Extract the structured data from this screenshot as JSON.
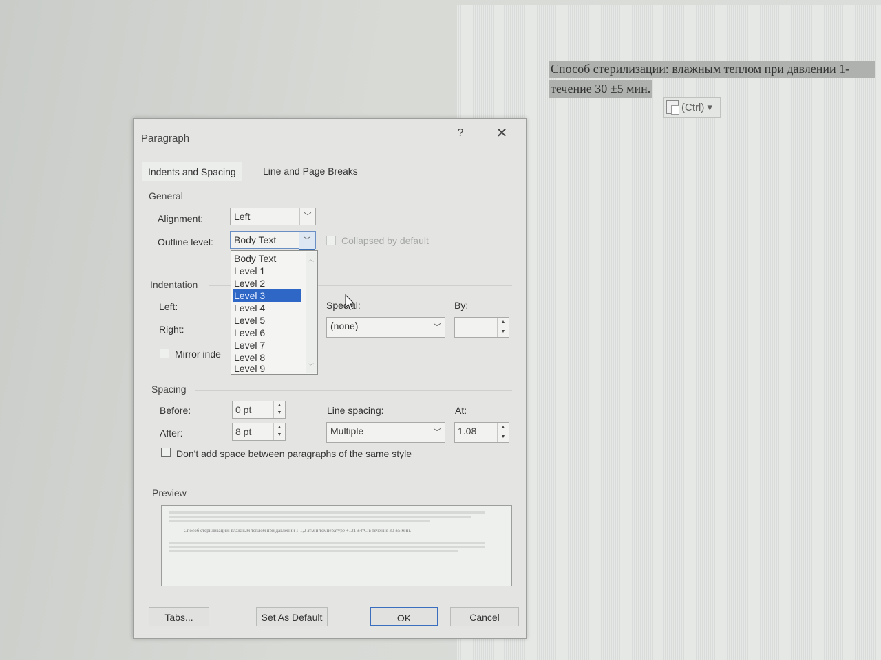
{
  "document": {
    "line1": "Способ стерилизации: влажным теплом при давлении 1-",
    "line2": "течение 30 ±5 мин.",
    "paste_options": "(Ctrl) ▾"
  },
  "dialog": {
    "title": "Paragraph",
    "help": "?",
    "close": "✕",
    "tabs": [
      "Indents and Spacing",
      "Line and Page Breaks"
    ],
    "general": {
      "label": "General",
      "alignment_label": "Alignment:",
      "alignment_value": "Left",
      "outline_label": "Outline level:",
      "outline_value": "Body Text",
      "collapsed_label": "Collapsed by default"
    },
    "outline_dropdown": {
      "items": [
        "Body Text",
        "Level 1",
        "Level 2",
        "Level 3",
        "Level 4",
        "Level 5",
        "Level 6",
        "Level 7",
        "Level 8",
        "Level 9"
      ],
      "selected": "Level 3"
    },
    "indentation": {
      "label": "Indentation",
      "left_label": "Left:",
      "right_label": "Right:",
      "special_label": "Special:",
      "special_value": "(none)",
      "by_label": "By:",
      "mirror_label": "Mirror inde"
    },
    "spacing": {
      "label": "Spacing",
      "before_label": "Before:",
      "before_value": "0 pt",
      "after_label": "After:",
      "after_value": "8 pt",
      "line_spacing_label": "Line spacing:",
      "line_spacing_value": "Multiple",
      "at_label": "At:",
      "at_value": "1.08",
      "dont_add_label": "Don't add space between paragraphs of the same style"
    },
    "preview": {
      "label": "Preview",
      "sample": "Способ стерилизации: влажным теплом при давлении 1-1,2 атм и температуре +121 ±4°С в течение 30 ±5 мин."
    },
    "buttons": {
      "tabs": "Tabs...",
      "set_default": "Set As Default",
      "ok": "OK",
      "cancel": "Cancel"
    }
  }
}
